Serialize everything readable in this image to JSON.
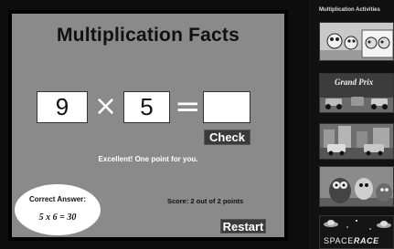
{
  "game": {
    "title": "Multiplication Facts",
    "factor_a": "9",
    "operator": "×",
    "factor_b": "5",
    "equals": "=",
    "answer_value": "",
    "check_label": "Check",
    "feedback": "Excellent! One point for you.",
    "correct_label": "Correct Answer:",
    "correct_equation": "5 x 6 = 30",
    "score_text": "Score: 2 out of 2 points",
    "restart_label": "Restart"
  },
  "sidebar": {
    "title": "Multiplication Activities",
    "thumbnails": [
      {
        "name": "counting-characters-activity",
        "label": ""
      },
      {
        "name": "grand-prix-activity",
        "label": "Grand Prix"
      },
      {
        "name": "city-cars-activity",
        "label": ""
      },
      {
        "name": "monster-activity",
        "label": ""
      },
      {
        "name": "space-race-activity",
        "label_prefix": "SPACE",
        "label_suffix": "RACE"
      }
    ]
  }
}
